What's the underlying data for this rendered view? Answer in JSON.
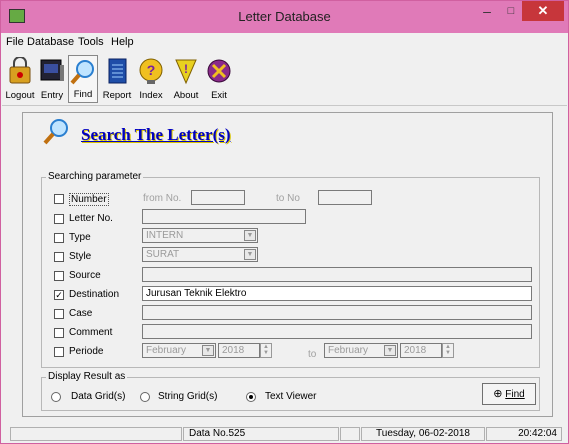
{
  "window": {
    "title": "Letter Database",
    "min": "–",
    "max": "□",
    "close": "✕"
  },
  "menu": [
    "File",
    "Database",
    "Tools",
    "Help"
  ],
  "toolbar": [
    "Logout",
    "Entry",
    "Find",
    "Report",
    "Index",
    "About",
    "Exit"
  ],
  "header": {
    "title": "Search The Letter(s)"
  },
  "search_params": {
    "group_label": "Searching parameter",
    "number": {
      "label": "Number",
      "from_label": "from No.",
      "to_label": "to No",
      "from_value": "",
      "to_value": "",
      "checked": false
    },
    "letter_no": {
      "label": "Letter No.",
      "value": "",
      "checked": false
    },
    "type": {
      "label": "Type",
      "value": "INTERN",
      "checked": false
    },
    "style": {
      "label": "Style",
      "value": "SURAT",
      "checked": false
    },
    "source": {
      "label": "Source",
      "value": "",
      "checked": false
    },
    "destination": {
      "label": "Destination",
      "value": "Jurusan Teknik Elektro",
      "checked": true
    },
    "case": {
      "label": "Case",
      "value": "",
      "checked": false
    },
    "comment": {
      "label": "Comment",
      "value": "",
      "checked": false
    },
    "periode": {
      "label": "Periode",
      "from_month": "February",
      "from_year": "2018",
      "to_label": "to",
      "to_month": "February",
      "to_year": "2018",
      "checked": false
    }
  },
  "display": {
    "group_label": "Display Result as",
    "options": [
      "Data Grid(s)",
      "String Grid(s)",
      "Text Viewer"
    ],
    "selected": "Text Viewer",
    "find_label": "Find"
  },
  "status": {
    "left": "",
    "data": "Data No.525",
    "middle": "",
    "date": "Tuesday, 06-02-2018",
    "time": "20:42:04"
  },
  "check_glyph": "✓"
}
